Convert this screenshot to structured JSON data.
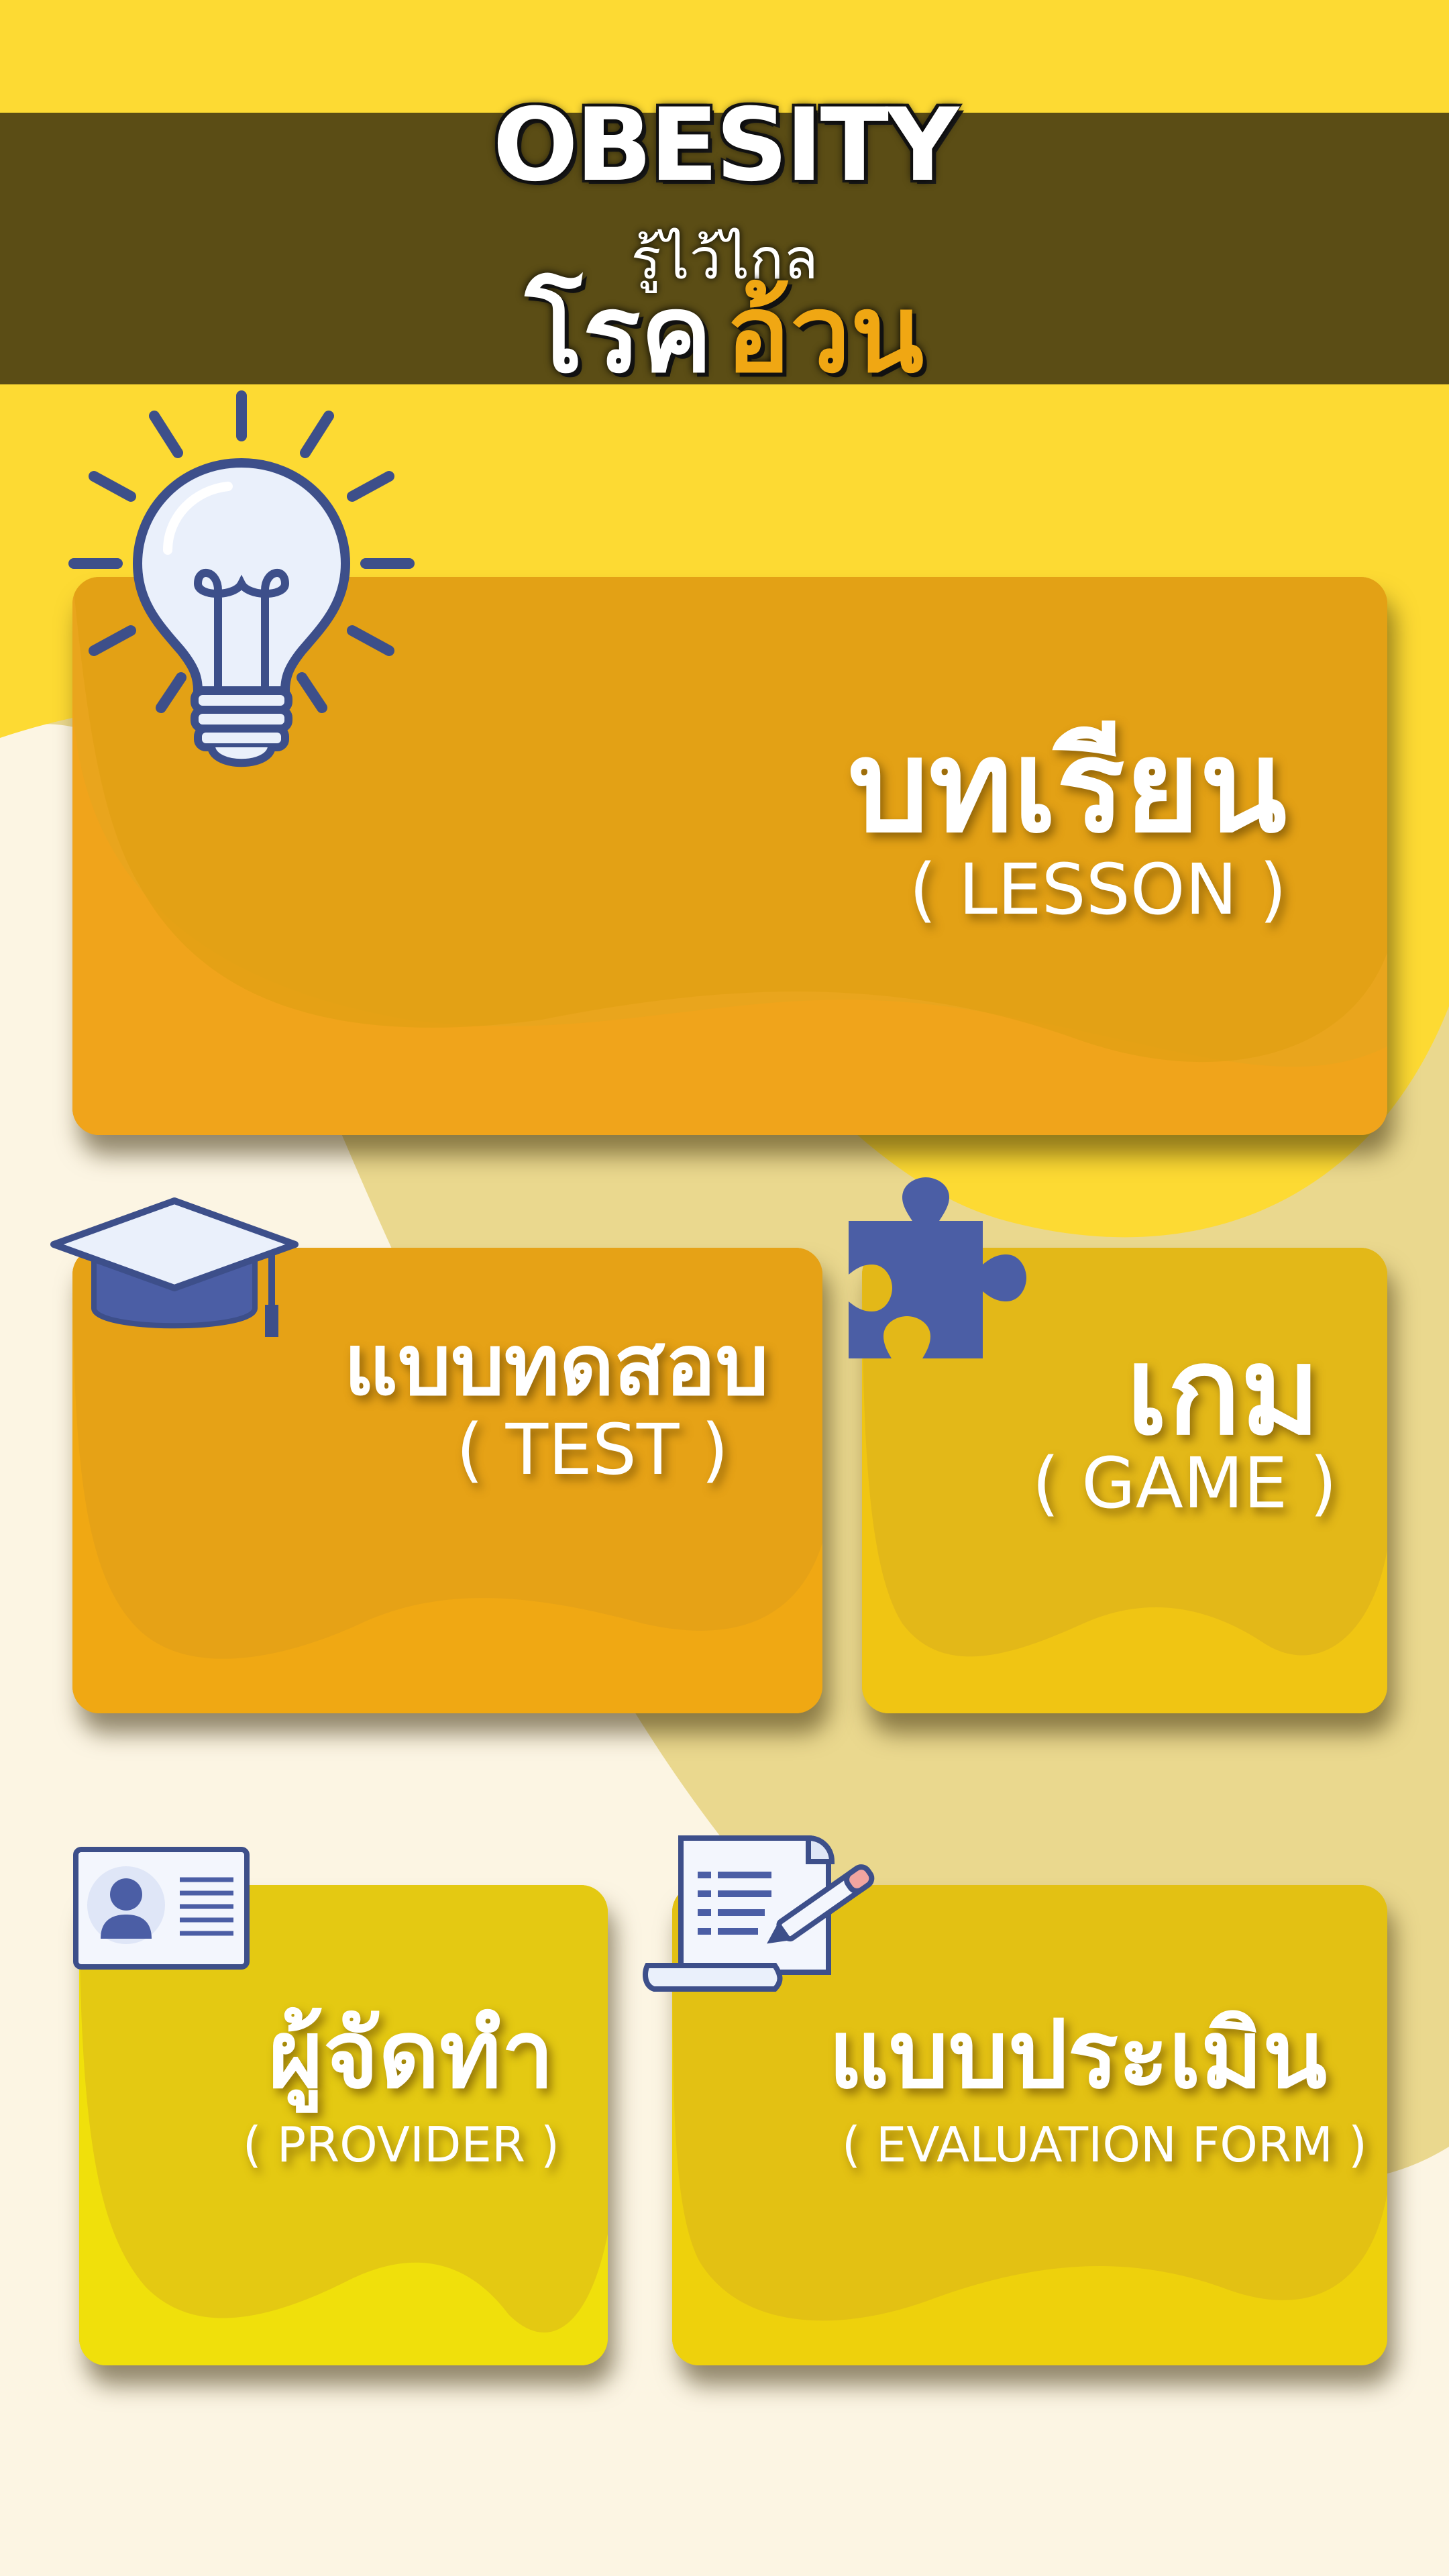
{
  "header": {
    "title_en": "OBESITY",
    "subtitle_th": "รู้ไว้ไกล",
    "title_th_part1": "โรค",
    "title_th_part2": "อ้วน"
  },
  "menu": {
    "lesson": {
      "label_th": "บทเรียน",
      "label_en": "( LESSON )",
      "icon": "lightbulb-icon"
    },
    "test": {
      "label_th": "แบบทดสอบ",
      "label_en": "( TEST )",
      "icon": "graduation-cap-icon"
    },
    "game": {
      "label_th": "เกม",
      "label_en": "( GAME )",
      "icon": "puzzle-piece-icon"
    },
    "provider": {
      "label_th": "ผู้จัดทำ",
      "label_en": "( PROVIDER )",
      "icon": "id-card-icon"
    },
    "evaluation": {
      "label_th": "แบบประเมิน",
      "label_en": "( EVALUATION FORM )",
      "icon": "scroll-pen-icon"
    }
  },
  "colors": {
    "background_top": "#fdda33",
    "header_band": "#5b4d15",
    "accent_orange": "#f0a713",
    "icon_blue": "#4b5ea5"
  }
}
